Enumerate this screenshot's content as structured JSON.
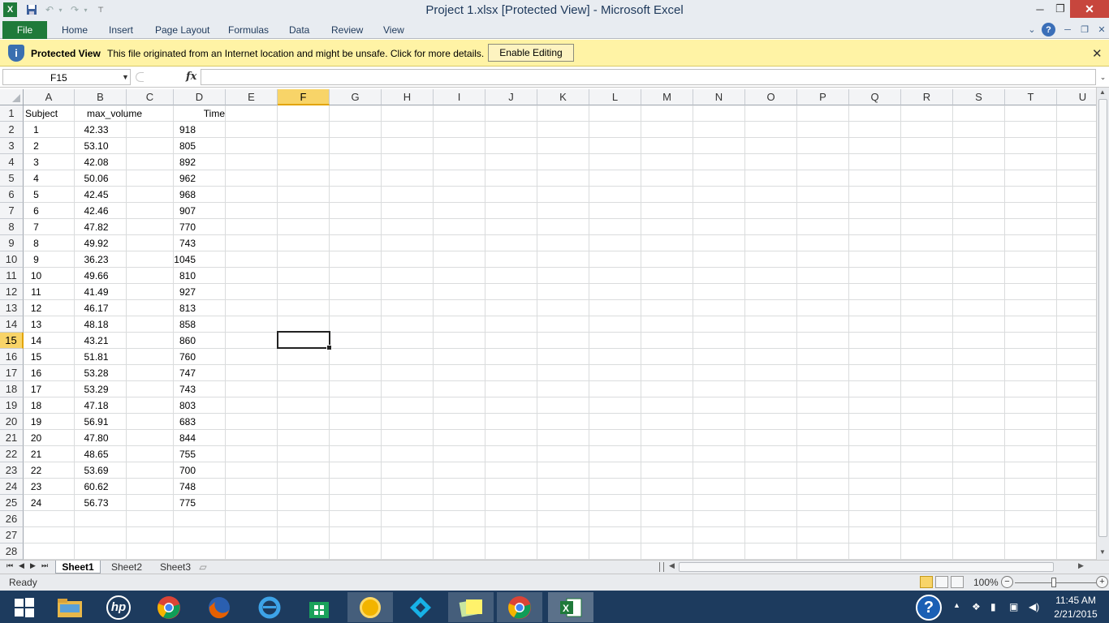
{
  "window": {
    "title": "Project 1.xlsx  [Protected View]  -  Microsoft Excel",
    "app_icon": "excel-app-icon",
    "controls": {
      "minimize": "─",
      "restore": "❐",
      "close": "✕"
    }
  },
  "quick_access": {
    "save_icon": "save-icon",
    "undo_icon": "undo-icon",
    "redo_icon": "redo-icon",
    "customize_icon": "customize-qat-icon"
  },
  "ribbon": {
    "file_label": "File",
    "tabs": [
      "Home",
      "Insert",
      "Page Layout",
      "Formulas",
      "Data",
      "Review",
      "View"
    ],
    "right_icons": [
      "minimize-ribbon-icon",
      "help-icon",
      "doc-minimize-icon",
      "doc-restore-icon",
      "doc-close-icon"
    ]
  },
  "protected_view": {
    "title": "Protected View",
    "message": "This file originated from an Internet location and might be unsafe. Click for more details.",
    "button": "Enable Editing",
    "close": "✕",
    "color": "#fff3a5"
  },
  "formula_bar": {
    "name_box": "F15",
    "fx": "fx",
    "formula": ""
  },
  "grid": {
    "columns": [
      "A",
      "B",
      "C",
      "D",
      "E",
      "F",
      "G",
      "H",
      "I",
      "J",
      "K",
      "L",
      "M",
      "N",
      "O",
      "P",
      "Q",
      "R",
      "S",
      "T",
      "U"
    ],
    "selected_column": "F",
    "rows": [
      "1",
      "2",
      "3",
      "4",
      "5",
      "6",
      "7",
      "8",
      "9",
      "10",
      "11",
      "12",
      "13",
      "14",
      "15",
      "16",
      "17",
      "18",
      "19",
      "20",
      "21",
      "22",
      "23",
      "24",
      "25",
      "26",
      "27",
      "28"
    ],
    "selected_row": "15",
    "headers": {
      "a": "Subject",
      "b": "max_volume",
      "d": "Time"
    },
    "data": [
      [
        "1",
        "42.33",
        "918"
      ],
      [
        "2",
        "53.10",
        "805"
      ],
      [
        "3",
        "42.08",
        "892"
      ],
      [
        "4",
        "50.06",
        "962"
      ],
      [
        "5",
        "42.45",
        "968"
      ],
      [
        "6",
        "42.46",
        "907"
      ],
      [
        "7",
        "47.82",
        "770"
      ],
      [
        "8",
        "49.92",
        "743"
      ],
      [
        "9",
        "36.23",
        "1045"
      ],
      [
        "10",
        "49.66",
        "810"
      ],
      [
        "11",
        "41.49",
        "927"
      ],
      [
        "12",
        "46.17",
        "813"
      ],
      [
        "13",
        "48.18",
        "858"
      ],
      [
        "14",
        "43.21",
        "860"
      ],
      [
        "15",
        "51.81",
        "760"
      ],
      [
        "16",
        "53.28",
        "747"
      ],
      [
        "17",
        "53.29",
        "743"
      ],
      [
        "18",
        "47.18",
        "803"
      ],
      [
        "19",
        "56.91",
        "683"
      ],
      [
        "20",
        "47.80",
        "844"
      ],
      [
        "21",
        "48.65",
        "755"
      ],
      [
        "22",
        "53.69",
        "700"
      ],
      [
        "23",
        "60.62",
        "748"
      ],
      [
        "24",
        "56.73",
        "775"
      ]
    ]
  },
  "sheets": {
    "tabs": [
      "Sheet1",
      "Sheet2",
      "Sheet3"
    ],
    "active": "Sheet1"
  },
  "status": {
    "text": "Ready",
    "zoom": "100%",
    "zoom_level_percent": 100
  },
  "taskbar": {
    "apps": [
      "start-button",
      "file-explorer-icon",
      "hp-icon",
      "chrome-icon",
      "firefox-icon",
      "ie-icon",
      "store-icon",
      "media-app-icon",
      "kodi-icon",
      "sticky-notes-icon",
      "chrome-window-icon",
      "excel-window-icon"
    ],
    "time": "11:45 AM",
    "date": "2/21/2015"
  }
}
